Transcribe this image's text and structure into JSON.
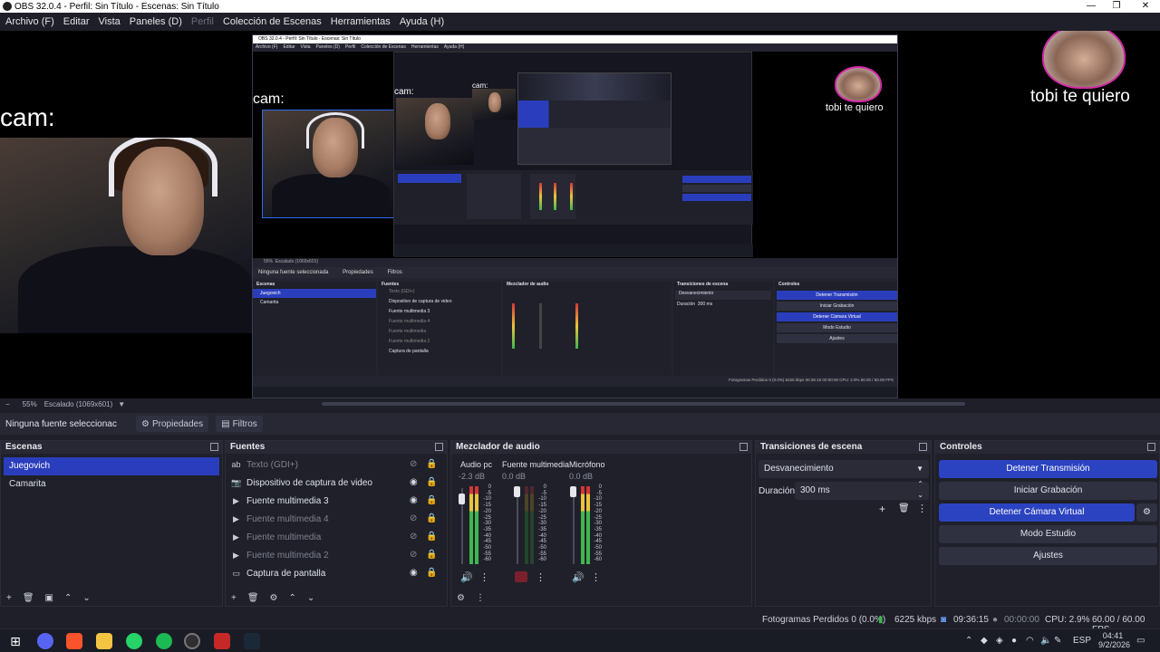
{
  "window": {
    "title": "OBS 32.0.4 - Perfil: Sin Título - Escenas: Sin Título",
    "min": "—",
    "max": "❐",
    "close": "✕"
  },
  "menu": [
    "Archivo (F)",
    "Editar",
    "Vista",
    "Paneles (D)",
    "Perfil",
    "Colección de Escenas",
    "Herramientas",
    "Ayuda (H)"
  ],
  "menu_disabled_index": 4,
  "preview": {
    "cam_label": "cam:",
    "overlay_text": "tobi te quiero",
    "nested_title": "OBS 32.0.4 - Perfil: Sin Título - Escenas: Sin Título",
    "nested_menu": [
      "Archivo (F)",
      "Editar",
      "Vista",
      "Paneles (D)",
      "Perfil",
      "Colección de Escenas",
      "Herramientas",
      "Ayuda (H)"
    ],
    "nested_zoom": "55%",
    "nested_scaled": "Escalado (1069x601)",
    "nested_no_source": "Ninguna fuente seleccionada",
    "nested_props": "Propiedades",
    "nested_filters": "Filtros",
    "nested_scenes_hdr": "Escenas",
    "nested_sources_hdr": "Fuentes",
    "nested_mixer_hdr": "Mezclador de audio",
    "nested_trans_hdr": "Transiciones de escena",
    "nested_controls_hdr": "Controles",
    "nested_scenes": [
      "Juegovich",
      "Camarita"
    ],
    "nested_sources": [
      "Texto (GDI+)",
      "Dispositivo de captura de video",
      "Fuente multimedia 3",
      "Fuente multimedia 4",
      "Fuente multimedia",
      "Fuente multimedia 2",
      "Captura de pantalla"
    ],
    "nested_trans": "Desvanecimiento",
    "nested_dur_label": "Duración",
    "nested_dur": "300 ms",
    "nested_controls": [
      "Detener Transmisión",
      "Iniciar Grabación",
      "Detener Cámara Virtual",
      "Modo Estudio",
      "Ajustes"
    ],
    "nested_status": "Fotogramas Perdidos 0 (0.0%)   6225 kbps   00:36:15   00:00:00   CPU: 2.9%   60.00 / 60.00 FPS"
  },
  "zoombar": {
    "minus": "−",
    "zoom": "55%",
    "scaled": "Escalado (1069x601)"
  },
  "source_toolbar": {
    "no_source": "Ninguna fuente seleccionac",
    "properties": "Propiedades",
    "filters": "Filtros"
  },
  "scenes": {
    "header": "Escenas",
    "items": [
      "Juegovich",
      "Camarita"
    ],
    "selected_index": 0
  },
  "sources": {
    "header": "Fuentes",
    "items": [
      {
        "icon": "ab",
        "label": "Texto (GDI+)",
        "visible": false
      },
      {
        "icon": "📷",
        "label": "Dispositivo de captura de video",
        "visible": true
      },
      {
        "icon": "▶",
        "label": "Fuente multimedia 3",
        "visible": true
      },
      {
        "icon": "▶",
        "label": "Fuente multimedia 4",
        "visible": false
      },
      {
        "icon": "▶",
        "label": "Fuente multimedia",
        "visible": false
      },
      {
        "icon": "▶",
        "label": "Fuente multimedia 2",
        "visible": false
      },
      {
        "icon": "▭",
        "label": "Captura de pantalla",
        "visible": true
      }
    ]
  },
  "mixer": {
    "header": "Mezclador de audio",
    "channels": [
      {
        "name": "Audio pc",
        "db": "-2.3 dB",
        "level": 0.8,
        "muted": false
      },
      {
        "name": "Fuente multimedia",
        "db": "0.0 dB",
        "level": 0.0,
        "muted": true
      },
      {
        "name": "Micrófono",
        "db": "0.0 dB",
        "level": 0.85,
        "muted": false
      }
    ],
    "scale": [
      "0",
      "-5",
      "-10",
      "-15",
      "-20",
      "-25",
      "-30",
      "-35",
      "-40",
      "-45",
      "-50",
      "-55",
      "-60"
    ]
  },
  "transitions": {
    "header": "Transiciones de escena",
    "selected": "Desvanecimiento",
    "duration_label": "Duración",
    "duration": "300 ms"
  },
  "controls": {
    "header": "Controles",
    "stream": "Detener Transmisión",
    "record": "Iniciar Grabación",
    "virtualcam": "Detener Cámara Virtual",
    "studio": "Modo Estudio",
    "settings": "Ajustes"
  },
  "status": {
    "dropped": "Fotogramas Perdidos 0 (0.0%)",
    "bitrate": "6225 kbps",
    "stream_time": "09:36:15",
    "rec_time": "00:00:00",
    "cpu": "CPU: 2.9%",
    "fps": "60.00 / 60.00 FPS"
  },
  "taskbar": {
    "lang": "ESP",
    "time": "04:41",
    "date": "9/2/2026"
  }
}
